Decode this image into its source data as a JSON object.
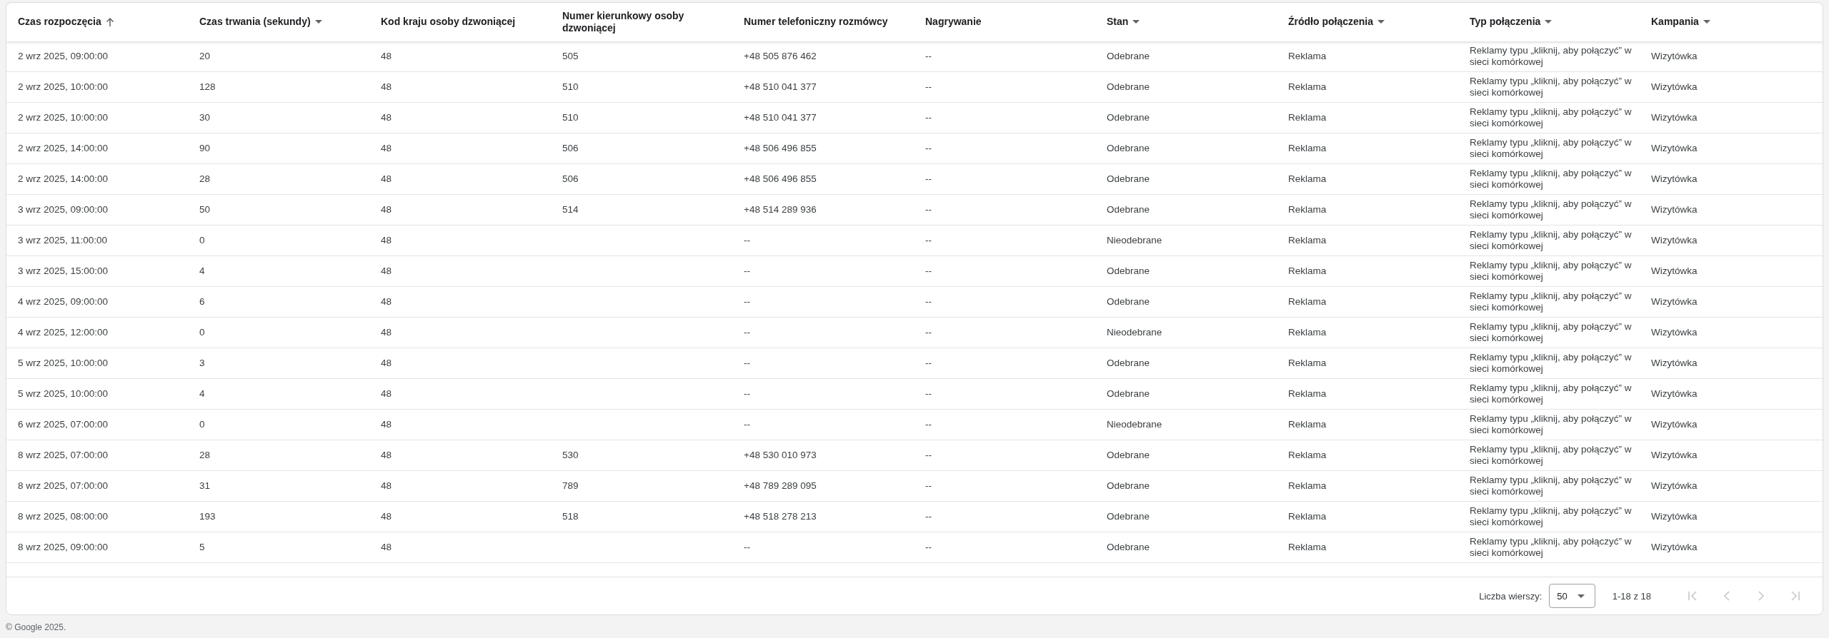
{
  "table": {
    "columns": [
      {
        "label": "Czas rozpoczęcia",
        "sorted": true,
        "menu": false
      },
      {
        "label": "Czas trwania (sekundy)",
        "sorted": false,
        "menu": true
      },
      {
        "label": "Kod kraju osoby dzwoniącej",
        "sorted": false,
        "menu": false
      },
      {
        "label": "Numer kierunkowy osoby dzwoniącej",
        "sorted": false,
        "menu": false
      },
      {
        "label": "Numer telefoniczny rozmówcy",
        "sorted": false,
        "menu": false
      },
      {
        "label": "Nagrywanie",
        "sorted": false,
        "menu": false
      },
      {
        "label": "Stan",
        "sorted": false,
        "menu": true
      },
      {
        "label": "Źródło połączenia",
        "sorted": false,
        "menu": true
      },
      {
        "label": "Typ połączenia",
        "sorted": false,
        "menu": true
      },
      {
        "label": "Kampania",
        "sorted": false,
        "menu": true
      }
    ],
    "rows": [
      {
        "cells": [
          "2 wrz 2025, 09:00:00",
          "20",
          "48",
          "505",
          "+48 505 876 462",
          "--",
          "Odebrane",
          "Reklama",
          "Reklamy typu „kliknij, aby połączyć” w sieci komórkowej",
          "Wizytówka"
        ]
      },
      {
        "cells": [
          "2 wrz 2025, 10:00:00",
          "128",
          "48",
          "510",
          "+48 510 041 377",
          "--",
          "Odebrane",
          "Reklama",
          "Reklamy typu „kliknij, aby połączyć” w sieci komórkowej",
          "Wizytówka"
        ]
      },
      {
        "cells": [
          "2 wrz 2025, 10:00:00",
          "30",
          "48",
          "510",
          "+48 510 041 377",
          "--",
          "Odebrane",
          "Reklama",
          "Reklamy typu „kliknij, aby połączyć” w sieci komórkowej",
          "Wizytówka"
        ]
      },
      {
        "cells": [
          "2 wrz 2025, 14:00:00",
          "90",
          "48",
          "506",
          "+48 506 496 855",
          "--",
          "Odebrane",
          "Reklama",
          "Reklamy typu „kliknij, aby połączyć” w sieci komórkowej",
          "Wizytówka"
        ]
      },
      {
        "cells": [
          "2 wrz 2025, 14:00:00",
          "28",
          "48",
          "506",
          "+48 506 496 855",
          "--",
          "Odebrane",
          "Reklama",
          "Reklamy typu „kliknij, aby połączyć” w sieci komórkowej",
          "Wizytówka"
        ]
      },
      {
        "cells": [
          "3 wrz 2025, 09:00:00",
          "50",
          "48",
          "514",
          "+48 514 289 936",
          "--",
          "Odebrane",
          "Reklama",
          "Reklamy typu „kliknij, aby połączyć” w sieci komórkowej",
          "Wizytówka"
        ]
      },
      {
        "cells": [
          "3 wrz 2025, 11:00:00",
          "0",
          "48",
          null,
          "--",
          "--",
          "Nieodebrane",
          "Reklama",
          "Reklamy typu „kliknij, aby połączyć” w sieci komórkowej",
          "Wizytówka"
        ]
      },
      {
        "cells": [
          "3 wrz 2025, 15:00:00",
          "4",
          "48",
          null,
          "--",
          "--",
          "Odebrane",
          "Reklama",
          "Reklamy typu „kliknij, aby połączyć” w sieci komórkowej",
          "Wizytówka"
        ]
      },
      {
        "cells": [
          "4 wrz 2025, 09:00:00",
          "6",
          "48",
          null,
          "--",
          "--",
          "Odebrane",
          "Reklama",
          "Reklamy typu „kliknij, aby połączyć” w sieci komórkowej",
          "Wizytówka"
        ]
      },
      {
        "cells": [
          "4 wrz 2025, 12:00:00",
          "0",
          "48",
          null,
          "--",
          "--",
          "Nieodebrane",
          "Reklama",
          "Reklamy typu „kliknij, aby połączyć” w sieci komórkowej",
          "Wizytówka"
        ]
      },
      {
        "cells": [
          "5 wrz 2025, 10:00:00",
          "3",
          "48",
          null,
          "--",
          "--",
          "Odebrane",
          "Reklama",
          "Reklamy typu „kliknij, aby połączyć” w sieci komórkowej",
          "Wizytówka"
        ]
      },
      {
        "cells": [
          "5 wrz 2025, 10:00:00",
          "4",
          "48",
          null,
          "--",
          "--",
          "Odebrane",
          "Reklama",
          "Reklamy typu „kliknij, aby połączyć” w sieci komórkowej",
          "Wizytówka"
        ]
      },
      {
        "cells": [
          "6 wrz 2025, 07:00:00",
          "0",
          "48",
          null,
          "--",
          "--",
          "Nieodebrane",
          "Reklama",
          "Reklamy typu „kliknij, aby połączyć” w sieci komórkowej",
          "Wizytówka"
        ]
      },
      {
        "cells": [
          "8 wrz 2025, 07:00:00",
          "28",
          "48",
          "530",
          "+48 530 010 973",
          "--",
          "Odebrane",
          "Reklama",
          "Reklamy typu „kliknij, aby połączyć” w sieci komórkowej",
          "Wizytówka"
        ]
      },
      {
        "cells": [
          "8 wrz 2025, 07:00:00",
          "31",
          "48",
          "789",
          "+48 789 289 095",
          "--",
          "Odebrane",
          "Reklama",
          "Reklamy typu „kliknij, aby połączyć” w sieci komórkowej",
          "Wizytówka"
        ]
      },
      {
        "cells": [
          "8 wrz 2025, 08:00:00",
          "193",
          "48",
          "518",
          "+48 518 278 213",
          "--",
          "Odebrane",
          "Reklama",
          "Reklamy typu „kliknij, aby połączyć” w sieci komórkowej",
          "Wizytówka"
        ]
      },
      {
        "cells": [
          "8 wrz 2025, 09:00:00",
          "5",
          "48",
          null,
          "--",
          "--",
          "Odebrane",
          "Reklama",
          "Reklamy typu „kliknij, aby połączyć” w sieci komórkowej",
          "Wizytówka"
        ]
      }
    ]
  },
  "pagination": {
    "rows_label": "Liczba wierszy:",
    "rows_per_page": "50",
    "range": "1-18 z 18",
    "buttons": [
      {
        "kind": "first",
        "disabled": true
      },
      {
        "kind": "previous",
        "disabled": true
      },
      {
        "kind": "next",
        "disabled": true
      },
      {
        "kind": "last",
        "disabled": true
      }
    ]
  },
  "footer": {
    "copyright": "© Google 2025."
  }
}
